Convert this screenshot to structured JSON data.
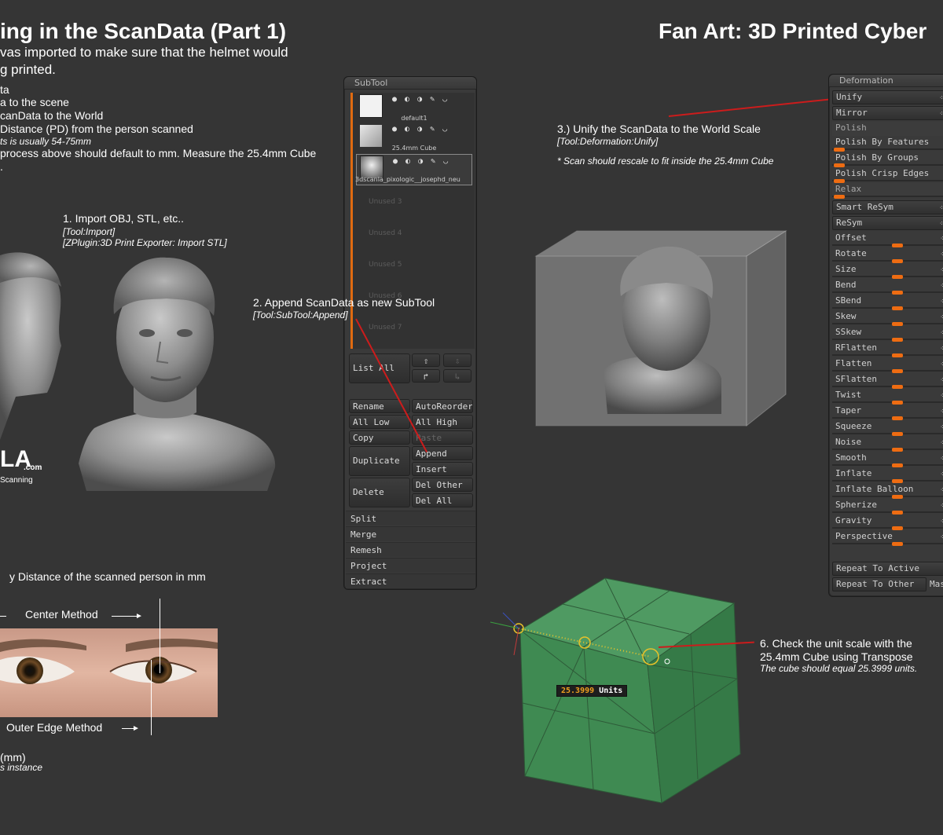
{
  "headers": {
    "left_title": "ing in the ScanData (Part 1)",
    "right_title": "Fan Art: 3D Printed Cyber"
  },
  "intro": {
    "line1": "vas imported to make sure that the helmet would",
    "line2": "g printed.",
    "list": [
      "ta",
      "a to the scene",
      "canData to the World",
      "Distance (PD) from the person scanned"
    ],
    "note": "ts is usually 54-75mm",
    "measure": "process above should default to mm. Measure the 25.4mm Cube",
    "trail": "."
  },
  "steps": {
    "s1_title": "1. Import OBJ, STL, etc..",
    "s1_note1": "[Tool:Import]",
    "s1_note2": "[ZPlugin:3D Print Exporter: Import STL]",
    "s2_title": "2. Append ScanData as new SubTool",
    "s2_note": "[Tool:SubTool:Append]",
    "s3_title": "3.) Unify the ScanData to the World Scale",
    "s3_note": "[Tool:Deformation:Unify]",
    "s3_note2": "* Scan should rescale to fit inside the 25.4mm Cube",
    "s6_title_1": "6. Check the unit scale with the",
    "s6_title_2": "25.4mm Cube using Transpose",
    "s6_note": "The cube should equal 25.3999 units."
  },
  "logo": {
    "text": "LA",
    "com": ".com",
    "tag": "Scanning"
  },
  "pd": {
    "title": "y Distance of the scanned person in mm",
    "center": "Center Method",
    "outer": "Outer Edge Method",
    "mm": "(mm)",
    "instance": "s instance"
  },
  "subtool": {
    "header": "SubTool",
    "items": [
      {
        "name": "default1"
      },
      {
        "name": "25.4mm  Cube"
      },
      {
        "name": "3dscanla_pixologic__josephd_neu"
      }
    ],
    "unused": [
      "Unused  3",
      "Unused  4",
      "Unused  5",
      "Unused  6",
      "Unused  7"
    ],
    "list_all": "List All",
    "buttons": {
      "rename": "Rename",
      "autoreorder": "AutoReorder",
      "all_low": "All Low",
      "all_high": "All High",
      "copy": "Copy",
      "paste": "Paste",
      "duplicate": "Duplicate",
      "append": "Append",
      "insert": "Insert",
      "delete": "Delete",
      "del_other": "Del Other",
      "del_all": "Del All"
    },
    "sections": [
      "Split",
      "Merge",
      "Remesh",
      "Project",
      "Extract"
    ]
  },
  "deformation": {
    "header": "Deformation",
    "unify": "Unify",
    "mirror": "Mirror",
    "polish": "Polish",
    "polish_features": "Polish By Features",
    "polish_groups": "Polish By Groups",
    "polish_crisp": "Polish Crisp Edges",
    "relax": "Relax",
    "smart_resym": "Smart ReSym",
    "resym": "ReSym",
    "sliders": [
      "Offset",
      "Rotate",
      "Size",
      "Bend",
      "SBend",
      "Skew",
      "SSkew",
      "RFlatten",
      "Flatten",
      "SFlatten",
      "Twist",
      "Taper",
      "Squeeze",
      "Noise",
      "Smooth",
      "Inflate",
      "Inflate Balloon",
      "Spherize",
      "Gravity",
      "Perspective"
    ],
    "repeat_active": "Repeat To Active",
    "repeat_other": "Repeat To Other",
    "mas": "Mas"
  },
  "transpose": {
    "units_value": "25.3999",
    "units_label": "Units"
  },
  "colors": {
    "background": "#353535",
    "accent_orange": "#ee6c12",
    "annotation_red": "#cc1c1c",
    "cube_green": "#3f8a52"
  }
}
